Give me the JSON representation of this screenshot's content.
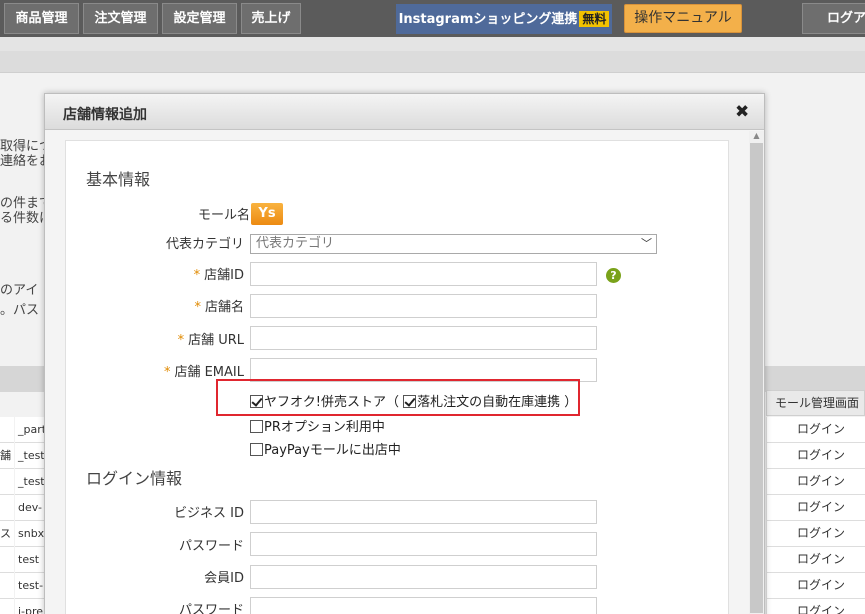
{
  "nav": {
    "items": [
      "商品管理",
      "注文管理",
      "設定管理",
      "売上げ"
    ],
    "instagram": "Instagramショッピング連携",
    "instagram_badge": "無料",
    "manual": "操作マニュアル",
    "logout": "ログア"
  },
  "background": {
    "left_texts": [
      "取得につ",
      "連絡をお",
      "の件まで",
      "る件数に",
      "のアイ",
      "。パス"
    ],
    "table_right_header": "モール管理画面",
    "row_left": [
      "",
      "舗",
      "",
      "",
      "スト",
      "",
      "",
      ""
    ],
    "row_mid": [
      "_part",
      "_test",
      "_test",
      "dev-",
      "snbx",
      "test",
      "test-",
      "i-pre"
    ],
    "row_action": "ログイン"
  },
  "modal": {
    "title": "店舗情報追加",
    "basic_section": "基本情報",
    "mall_name_label": "モール名",
    "mall_logo": "Ys",
    "category_label": "代表カテゴリ",
    "category_value": "代表カテゴリ",
    "required_mark": "*",
    "store_id_label": "店舗ID",
    "store_name_label": "店舗名",
    "store_url_label": "店舗 URL",
    "store_email_label": "店舗 EMAIL",
    "help_icon": "?",
    "chk_yahoo_auction": "ヤフオク!併売ストア（",
    "chk_auto_stock": "落札注文の自動在庫連携 ）",
    "chk_pr_option": "PRオプション利用中",
    "chk_paypay": "PayPayモールに出店中",
    "login_section": "ログイン情報",
    "business_id_label": "ビジネス ID",
    "password_label": "パスワード",
    "member_id_label": "会員ID",
    "password2_label": "パスワード"
  },
  "colors": {
    "highlight": "#e0262f",
    "manual_button": "#f3b04a",
    "instagram": "#4f6a9a"
  }
}
